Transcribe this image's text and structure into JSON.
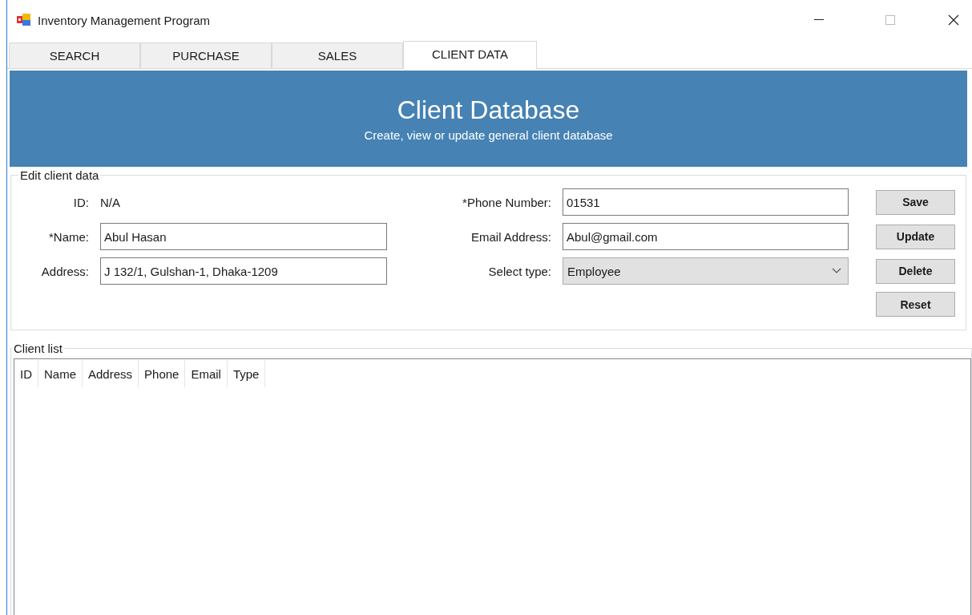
{
  "window": {
    "title": "Inventory Management Program"
  },
  "tabs": [
    {
      "label": "SEARCH",
      "selected": false
    },
    {
      "label": "PURCHASE",
      "selected": false
    },
    {
      "label": "SALES",
      "selected": false
    },
    {
      "label": "CLIENT DATA",
      "selected": true
    }
  ],
  "banner": {
    "title": "Client Database",
    "subtitle": "Create, view or update general client database"
  },
  "edit_group": {
    "title": "Edit client data",
    "left_fields": [
      {
        "kind": "readonly",
        "label": "ID:",
        "value": "N/A"
      },
      {
        "kind": "text",
        "label": "*Name:",
        "value": "Abul Hasan"
      },
      {
        "kind": "text",
        "label": "Address:",
        "value": "J 132/1, Gulshan-1, Dhaka-1209"
      }
    ],
    "right_fields": [
      {
        "kind": "text",
        "label": "*Phone Number:",
        "value": "01531"
      },
      {
        "kind": "text",
        "label": "Email Address:",
        "value": "Abul@gmail.com"
      },
      {
        "kind": "select",
        "label": "Select type:",
        "value": "Employee"
      }
    ],
    "buttons": [
      "Save",
      "Update",
      "Delete",
      "Reset"
    ]
  },
  "client_list": {
    "title": "Client list",
    "columns": [
      "ID",
      "Name",
      "Address",
      "Phone",
      "Email",
      "Type"
    ]
  }
}
